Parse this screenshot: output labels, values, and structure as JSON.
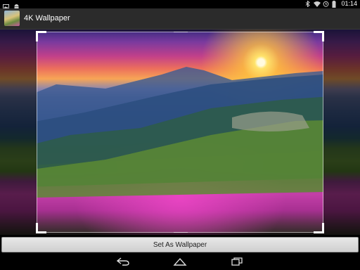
{
  "status_bar": {
    "time": "01:14",
    "icons": [
      "image-notification-icon",
      "android-notification-icon",
      "bluetooth-icon",
      "wifi-icon",
      "alarm-icon",
      "battery-icon"
    ]
  },
  "action_bar": {
    "app_title": "4K Wallpaper",
    "app_icon": "wallpaper-app-icon"
  },
  "image": {
    "description_icon": "mountain-sunset-wallpaper"
  },
  "buttons": {
    "set_wallpaper": "Set As Wallpaper"
  },
  "nav_bar": {
    "icons": [
      "back-icon",
      "home-icon",
      "recents-icon"
    ]
  },
  "colors": {
    "action_bar_bg": "#2b2b2b",
    "button_bg": "#dcdcdc"
  }
}
